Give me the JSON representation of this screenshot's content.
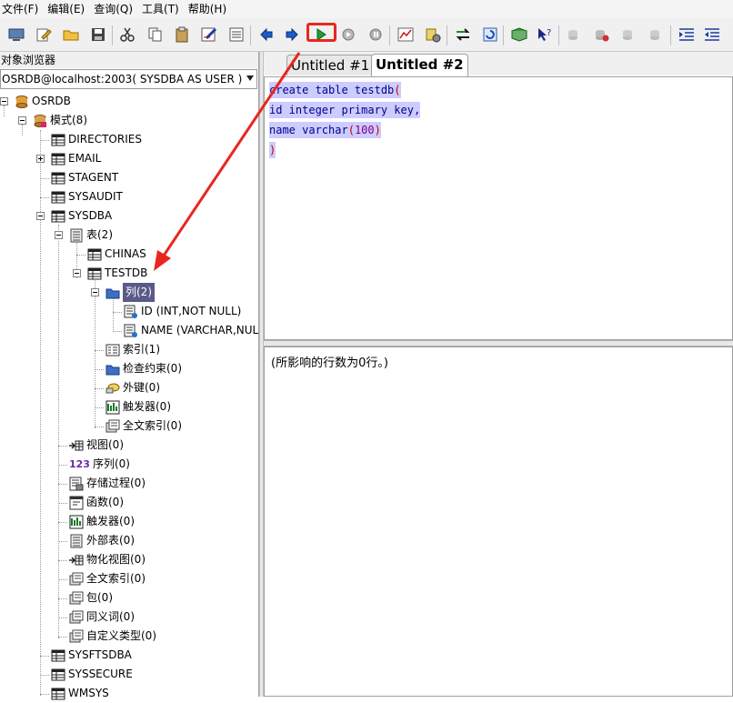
{
  "menu": [
    "文件(F)",
    "编辑(E)",
    "查询(Q)",
    "工具(T)",
    "帮助(H)"
  ],
  "explorer": {
    "title": "对象浏览器",
    "connection": "OSRDB@localhost:2003( SYSDBA AS USER )"
  },
  "tree": {
    "root": "OSRDB",
    "schemas": "模式(8)",
    "directories": "DIRECTORIES",
    "email": "EMAIL",
    "stagent": "STAGENT",
    "sysaudit": "SYSAUDIT",
    "sysdba": "SYSDBA",
    "tables": "表(2)",
    "chinas": "CHINAS",
    "testdb": "TESTDB",
    "columns": "列(2)",
    "col_id": "ID (INT,NOT NULL)",
    "col_name": "NAME (VARCHAR,NULL)",
    "indexes": "索引(1)",
    "check_constraints": "检查约束(0)",
    "foreign_keys": "外键(0)",
    "triggers_t": "触发器(0)",
    "fulltext_t": "全文索引(0)",
    "views": "视图(0)",
    "sequences": "序列(0)",
    "seq_icon_text": "123",
    "procedures": "存储过程(0)",
    "functions": "函数(0)",
    "triggers": "触发器(0)",
    "external_tables": "外部表(0)",
    "mviews": "物化视图(0)",
    "fulltext": "全文索引(0)",
    "packages": "包(0)",
    "synonyms": "同义词(0)",
    "custom_types": "自定义类型(0)",
    "sysftsdba": "SYSFTSDBA",
    "syssecure": "SYSSECURE",
    "wmsys": "WMSYS"
  },
  "tabs": [
    "Untitled #1",
    "Untitled #2"
  ],
  "active_tab": "Untitled #2",
  "editor": {
    "line1": "create table testdb",
    "line2": "id integer primary key,",
    "line3a": "name varchar",
    "line3num": "100",
    "open_paren": "(",
    "close_paren": ")"
  },
  "result_message": "(所影响的行数为0行。)",
  "colors": {
    "highlight": "#e8271f",
    "selection_bg": "#ccccff",
    "tree_selection": "#5a5a8a"
  }
}
